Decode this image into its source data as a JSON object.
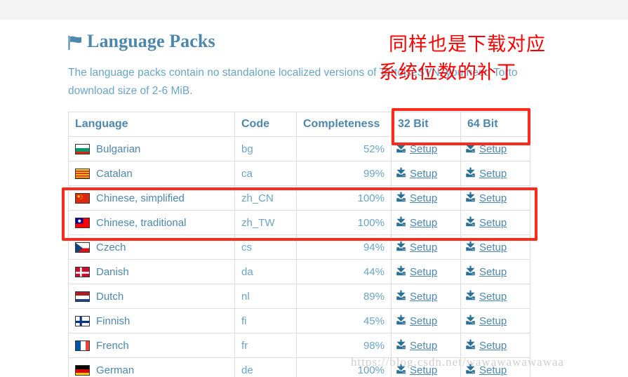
{
  "page": {
    "heading": "Language Packs",
    "heading_icon": "flag-icon",
    "description_line1": "The language packs contain no standalone localized versions of TortoiseSVN, you need Torto",
    "description_line2": "download size of 2-6 MiB."
  },
  "table": {
    "headers": {
      "language": "Language",
      "code": "Code",
      "completeness": "Completeness",
      "bit32": "32 Bit",
      "bit64": "64 Bit"
    },
    "setup_label": "Setup",
    "rows": [
      {
        "flag": "bulgaria-flag-icon",
        "language": "Bulgarian",
        "code": "bg",
        "completeness": "52%"
      },
      {
        "flag": "catalonia-flag-icon",
        "language": "Catalan",
        "code": "ca",
        "completeness": "99%"
      },
      {
        "flag": "china-flag-icon",
        "language": "Chinese, simplified",
        "code": "zh_CN",
        "completeness": "100%"
      },
      {
        "flag": "taiwan-flag-icon",
        "language": "Chinese, traditional",
        "code": "zh_TW",
        "completeness": "100%"
      },
      {
        "flag": "czech-flag-icon",
        "language": "Czech",
        "code": "cs",
        "completeness": "94%"
      },
      {
        "flag": "denmark-flag-icon",
        "language": "Danish",
        "code": "da",
        "completeness": "44%"
      },
      {
        "flag": "netherlands-flag-icon",
        "language": "Dutch",
        "code": "nl",
        "completeness": "89%"
      },
      {
        "flag": "finland-flag-icon",
        "language": "Finnish",
        "code": "fi",
        "completeness": "45%"
      },
      {
        "flag": "france-flag-icon",
        "language": "French",
        "code": "fr",
        "completeness": "98%"
      },
      {
        "flag": "germany-flag-icon",
        "language": "German",
        "code": "de",
        "completeness": "100%"
      }
    ]
  },
  "annotations": {
    "note_line1": "同样也是下载对应",
    "note_line2": "系统位数的补丁",
    "color": "#ff0000",
    "box_color": "#fd2b1b"
  },
  "watermark": {
    "text": "https://blog.csdn.net/wawawawawawaa"
  }
}
